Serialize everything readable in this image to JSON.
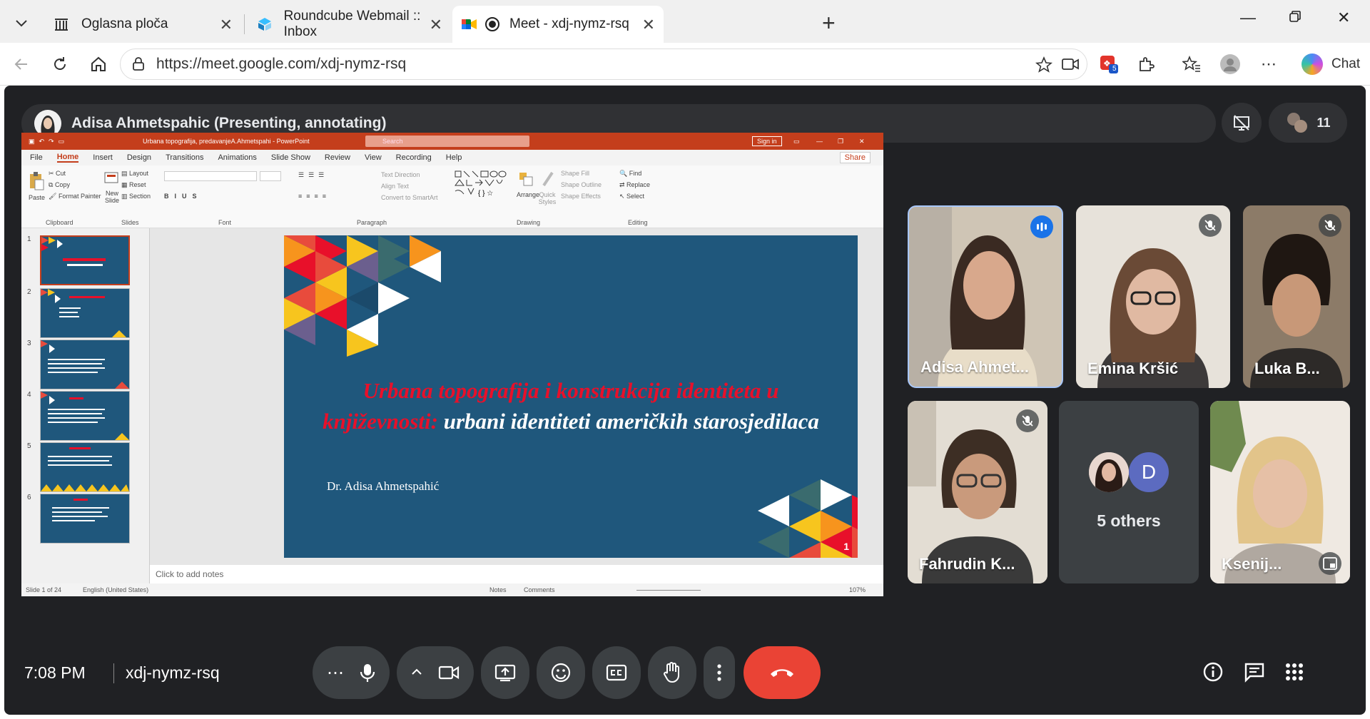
{
  "browser": {
    "tabs": [
      {
        "title": "Oglasna ploča"
      },
      {
        "title": "Roundcube Webmail :: Inbox"
      },
      {
        "title": "Meet - xdj-nymz-rsq"
      }
    ],
    "url": "https://meet.google.com/xdj-nymz-rsq",
    "chat_label": "Chat",
    "extension_badge": "5"
  },
  "meet": {
    "presenter_label": "Adisa Ahmetspahic (Presenting, annotating)",
    "participant_count": "11",
    "time": "7:08 PM",
    "meeting_code": "xdj-nymz-rsq",
    "participants": [
      {
        "name": "Adisa Ahmet...",
        "state": "speaking"
      },
      {
        "name": "Emina Kršić",
        "state": "muted"
      },
      {
        "name": "Luka B...",
        "state": "muted"
      },
      {
        "name": "Fahrudin K...",
        "state": "muted"
      },
      {
        "name": "Ksenij...",
        "state": "pinned"
      }
    ],
    "others": {
      "label": "5 others",
      "avatar_letter": "D"
    }
  },
  "ppt": {
    "window_title": "Urbana topografija, predavanjeA.Ahmetspahi  -  PowerPoint",
    "search_placeholder": "Search",
    "sign_in": "Sign in",
    "share": "Share",
    "menu": [
      "File",
      "Home",
      "Insert",
      "Design",
      "Transitions",
      "Animations",
      "Slide Show",
      "Review",
      "View",
      "Recording",
      "Help"
    ],
    "ribbon": {
      "clipboard": {
        "paste": "Paste",
        "cut": "Cut",
        "copy": "Copy",
        "format_painter": "Format Painter",
        "label": "Clipboard"
      },
      "slides": {
        "new_slide": "New Slide",
        "layout": "Layout",
        "reset": "Reset",
        "section": "Section",
        "label": "Slides"
      },
      "font": {
        "label": "Font"
      },
      "paragraph": {
        "text_direction": "Text Direction",
        "align_text": "Align Text",
        "convert": "Convert to SmartArt",
        "label": "Paragraph"
      },
      "drawing": {
        "arrange": "Arrange",
        "quick_styles": "Quick Styles",
        "shape_fill": "Shape Fill",
        "shape_outline": "Shape Outline",
        "shape_effects": "Shape Effects",
        "label": "Drawing"
      },
      "editing": {
        "find": "Find",
        "replace": "Replace",
        "select": "Select",
        "label": "Editing"
      }
    },
    "thumb_numbers": [
      "1",
      "2",
      "3",
      "4",
      "5",
      "6"
    ],
    "slide": {
      "title_red": "Urbana topografija i konstrukcija identiteta u književnosti:",
      "title_white": " urbani identiteti američkih starosjedilaca",
      "author": "Dr. Adisa Ahmetspahić",
      "number": "1"
    },
    "notes_placeholder": "Click to add notes",
    "status": {
      "slide_of": "Slide 1 of 24",
      "language": "English (United States)",
      "notes": "Notes",
      "comments": "Comments",
      "zoom": "107%"
    }
  }
}
